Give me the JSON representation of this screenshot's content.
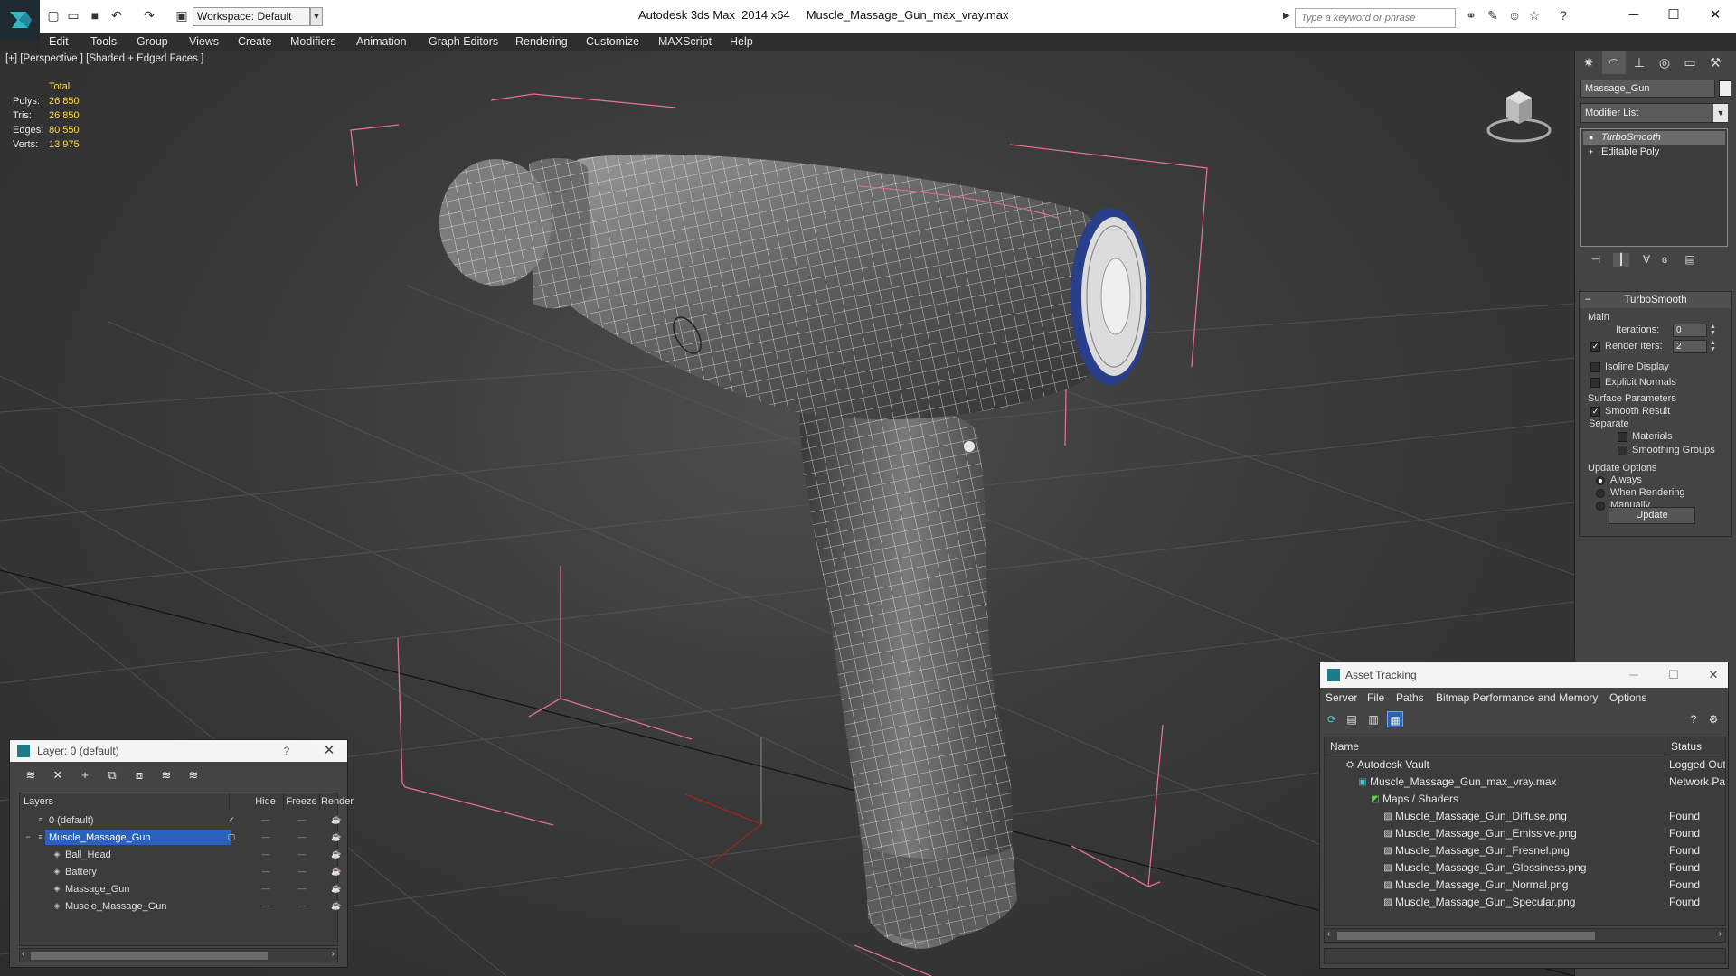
{
  "app": {
    "title": "Autodesk 3ds Max  2014 x64     Muscle_Massage_Gun_max_vray.max",
    "workspace": "Workspace: Default",
    "search_placeholder": "Type a keyword or phrase"
  },
  "menu": [
    "Edit",
    "Tools",
    "Group",
    "Views",
    "Create",
    "Modifiers",
    "Animation",
    "Graph Editors",
    "Rendering",
    "Customize",
    "MAXScript",
    "Help"
  ],
  "viewport": {
    "label": "[+] [Perspective ] [Shaded + Edged Faces ]",
    "stats": {
      "header": "Total",
      "rows": [
        {
          "label": "Polys:",
          "value": "26 850"
        },
        {
          "label": "Tris:",
          "value": "26 850"
        },
        {
          "label": "Edges:",
          "value": "80 550"
        },
        {
          "label": "Verts:",
          "value": "13 975"
        }
      ]
    }
  },
  "command_panel": {
    "object_name": "Massage_Gun",
    "modifier_list": "Modifier List",
    "stack": [
      {
        "label": "TurboSmooth",
        "selected": true,
        "icon": "lightbulb-icon"
      },
      {
        "label": "Editable Poly",
        "selected": false,
        "icon": "plus-icon"
      }
    ],
    "rollout": {
      "title": "TurboSmooth",
      "main_label": "Main",
      "iterations_label": "Iterations:",
      "iterations_value": "0",
      "render_iters_label": "Render Iters:",
      "render_iters_value": "2",
      "render_iters_checked": true,
      "isoline_label": "Isoline Display",
      "explicit_normals_label": "Explicit Normals",
      "surface_params_label": "Surface Parameters",
      "smooth_result_label": "Smooth Result",
      "separate_label": "Separate",
      "materials_label": "Materials",
      "smoothing_groups_label": "Smoothing Groups",
      "update_options_label": "Update Options",
      "always_label": "Always",
      "when_rendering_label": "When Rendering",
      "manually_label": "Manually",
      "update_button": "Update"
    }
  },
  "layer_dialog": {
    "title": "Layer: 0 (default)",
    "help": "?",
    "columns": [
      "Layers",
      "Hide",
      "Freeze",
      "Render"
    ],
    "rows": [
      {
        "name": "0 (default)",
        "indent": 0,
        "selected": false,
        "active": true
      },
      {
        "name": "Muscle_Massage_Gun",
        "indent": 0,
        "selected": true,
        "active": false
      },
      {
        "name": "Ball_Head",
        "indent": 1,
        "selected": false,
        "active": false
      },
      {
        "name": "Battery",
        "indent": 1,
        "selected": false,
        "active": false
      },
      {
        "name": "Massage_Gun",
        "indent": 1,
        "selected": false,
        "active": false
      },
      {
        "name": "Muscle_Massage_Gun",
        "indent": 1,
        "selected": false,
        "active": false
      }
    ]
  },
  "asset_tracking": {
    "title": "Asset Tracking",
    "menu": [
      "Server",
      "File",
      "Paths",
      "Bitmap Performance and Memory",
      "Options"
    ],
    "columns": [
      "Name",
      "Status"
    ],
    "rows": [
      {
        "name": "Autodesk Vault",
        "status": "Logged Out",
        "indent": 1
      },
      {
        "name": "Muscle_Massage_Gun_max_vray.max",
        "status": "Network Pat",
        "indent": 2
      },
      {
        "name": "Maps / Shaders",
        "status": "",
        "indent": 3
      },
      {
        "name": "Muscle_Massage_Gun_Diffuse.png",
        "status": "Found",
        "indent": 4
      },
      {
        "name": "Muscle_Massage_Gun_Emissive.png",
        "status": "Found",
        "indent": 4
      },
      {
        "name": "Muscle_Massage_Gun_Fresnel.png",
        "status": "Found",
        "indent": 4
      },
      {
        "name": "Muscle_Massage_Gun_Glossiness.png",
        "status": "Found",
        "indent": 4
      },
      {
        "name": "Muscle_Massage_Gun_Normal.png",
        "status": "Found",
        "indent": 4
      },
      {
        "name": "Muscle_Massage_Gun_Specular.png",
        "status": "Found",
        "indent": 4
      }
    ]
  },
  "colors": {
    "stat_value": "#ffd94a",
    "selection": "#2a62bd",
    "bbox": "#e0708c",
    "wire": "#ffffff"
  }
}
